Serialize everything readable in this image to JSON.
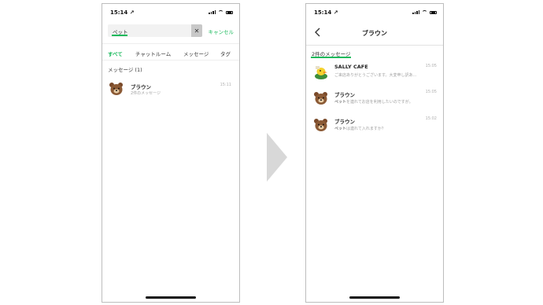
{
  "left": {
    "status_time": "15:14 ↗",
    "search_value": "ペット",
    "clear_label": "✕",
    "cancel_label": "キャンセル",
    "tabs": [
      {
        "label": "すべて"
      },
      {
        "label": "チャットルーム"
      },
      {
        "label": "メッセージ"
      },
      {
        "label": "タグ"
      }
    ],
    "section_header": "メッセージ (1)",
    "result": {
      "name": "ブラウン",
      "snippet": "2件のメッセージ",
      "time": "15:11"
    }
  },
  "right": {
    "status_time": "15:14 ↗",
    "title": "ブラウン",
    "count_label": "2件のメッセージ",
    "messages": [
      {
        "name": "SALLY CAFE",
        "snippet_pre": "",
        "snippet_hl": "",
        "snippet_post": "ご来店ありがとうございます。大変申し訳あ...",
        "time": "15:05"
      },
      {
        "name": "ブラウン",
        "snippet_pre": "",
        "snippet_hl": "ペット",
        "snippet_post": "を連れてお店を利用したいのですが。",
        "time": "15:05"
      },
      {
        "name": "ブラウン",
        "snippet_pre": "",
        "snippet_hl": "ペット",
        "snippet_post": "は連れて入れますか？",
        "time": "15:02"
      }
    ]
  },
  "colors": {
    "accent": "#19b95b",
    "arrow": "#d8d8d8"
  }
}
